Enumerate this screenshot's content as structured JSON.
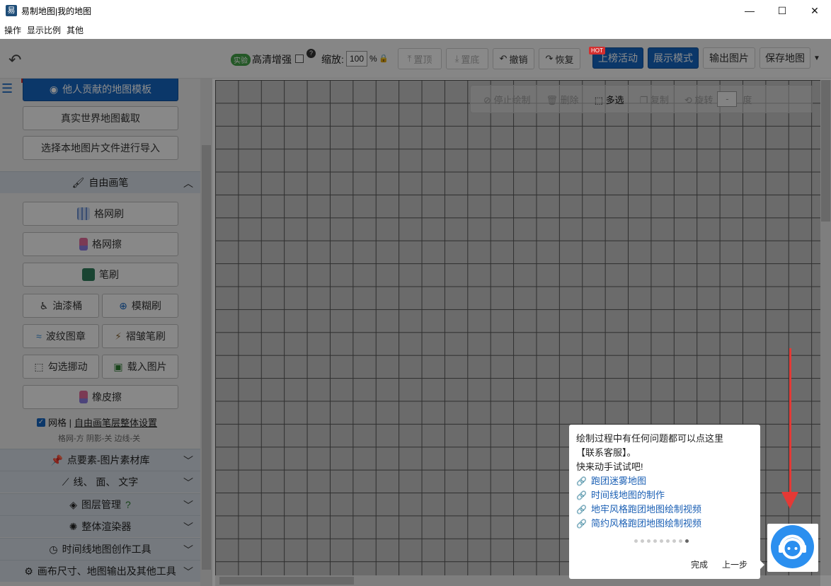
{
  "window": {
    "title": "易制地图|我的地图",
    "app_icon": "易"
  },
  "menu": [
    "操作",
    "显示比例",
    "其他"
  ],
  "toolbar": {
    "exp_badge": "实验",
    "hd_label": "高清增强",
    "zoom_label": "缩放:",
    "zoom_value": "100",
    "zoom_unit": "%",
    "top_label": "置顶",
    "bottom_label": "置底",
    "undo_label": "撤销",
    "redo_label": "恢复",
    "hot_badge": "HOT",
    "rank_label": "上榜活动",
    "show_label": "展示模式",
    "export_label": "输出图片",
    "save_label": "保存地图"
  },
  "sidebar": {
    "template_btn": "他人贡献的地图模板",
    "real_map_btn": "真实世界地图截取",
    "import_btn": "选择本地图片文件进行导入",
    "free_brush_section": "自由画笔",
    "grid_brush": "格网刷",
    "grid_eraser": "格网擦",
    "pen_brush": "笔刷",
    "paint_bucket": "油漆桶",
    "blur_brush": "模糊刷",
    "wave_stamp": "波纹图章",
    "wrinkle_brush": "褶皱笔刷",
    "hook_move": "勾选挪动",
    "load_image": "载入图片",
    "eraser": "橡皮擦",
    "grid_check_label": "网格 |",
    "layer_settings": "自由画笔层整体设置",
    "grid_info": "格网-方 阴影-关 边线-关",
    "sections": [
      {
        "label": "点要素-图片素材库"
      },
      {
        "label": "线、  面、  文字"
      },
      {
        "label": "图层管理"
      },
      {
        "label": "整体渲染器"
      },
      {
        "label": "时间线地图创作工具"
      },
      {
        "label": "画布尺寸、地图输出及其他工具"
      }
    ]
  },
  "canvas_tools": {
    "stop": "停止绘制",
    "delete": "删除",
    "multi_select": "多选",
    "copy": "复制",
    "rotate": "旋转",
    "rotate_value": "-",
    "degree": "度"
  },
  "tip": {
    "line1": "绘制过程中有任何问题都可以点这里",
    "line2": "【联系客服】。",
    "line3": "快来动手试试吧!",
    "links": [
      "跑团迷雾地图",
      "时间线地图的制作",
      "地牢风格跑团地图绘制视频",
      "简约风格跑团地图绘制视频"
    ],
    "done": "完成",
    "prev": "上一步"
  },
  "colors": {
    "accent": "#1565c0",
    "arrow": "#e53935",
    "support": "#2b8fef"
  }
}
